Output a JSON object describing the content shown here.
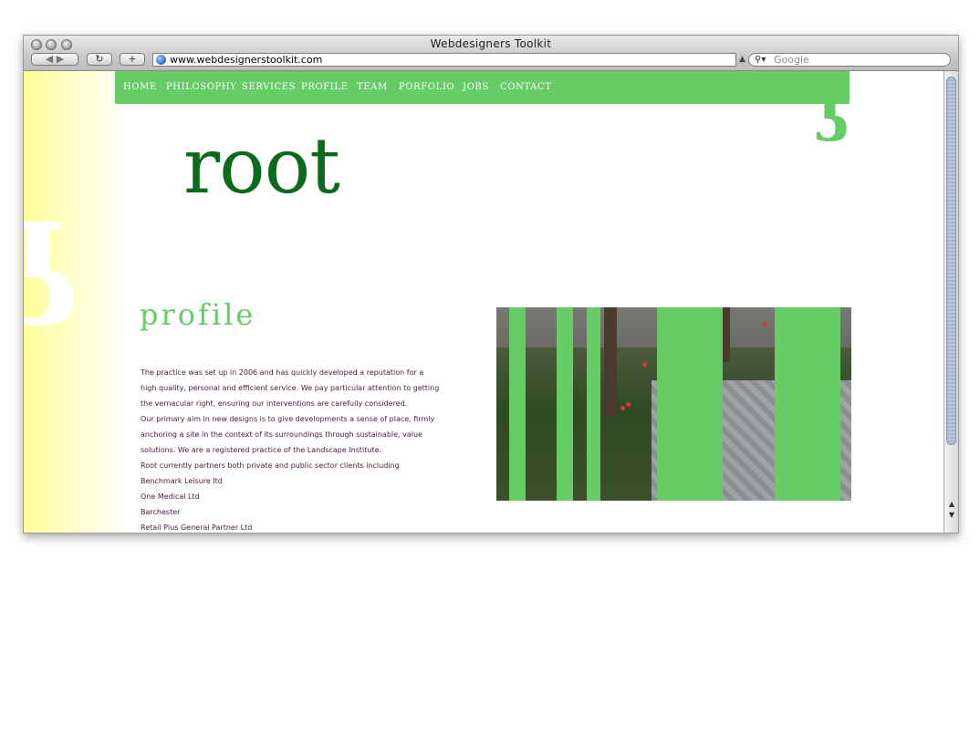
{
  "browser": {
    "title": "Webdesigners Toolkit",
    "url": "www.webdesignerstoolkit.com",
    "search_placeholder": "Google",
    "back_icon": "◀",
    "forward_icon": "▶",
    "reload_icon": "↻",
    "add_icon": "+"
  },
  "nav": {
    "items": [
      "HOME",
      "PHILOSOPHY",
      "SERVICES",
      "PROFILE",
      "TEAM",
      "PORFOLIO",
      "JOBS",
      "CONTACT"
    ]
  },
  "site": {
    "logo": "root",
    "decor_glyph": "ʖ"
  },
  "profile": {
    "title": "profile",
    "lines": [
      "The practice was set up in 2006 and has quickly developed a reputation for a",
      "high quality, personal and efficient service. We pay particular attention to getting",
      "the vernacular right, ensuring our interventions are carefully considered.",
      "Our primary aim in new designs is to give developments a sense of place, firmly",
      "anchoring a site in the context of its surroundings through sustainable, value",
      "solutions. We are a registered practice of the Landscape Institute.",
      "Root currently partners both private and public sector clients including",
      "Benchmark Leisure ltd",
      "One Medical Ltd",
      "Barchester",
      "Retail Plus General Partner Ltd"
    ]
  },
  "colors": {
    "accent": "#66cc66",
    "logo": "#0c6b1b",
    "text": "#47213f"
  }
}
